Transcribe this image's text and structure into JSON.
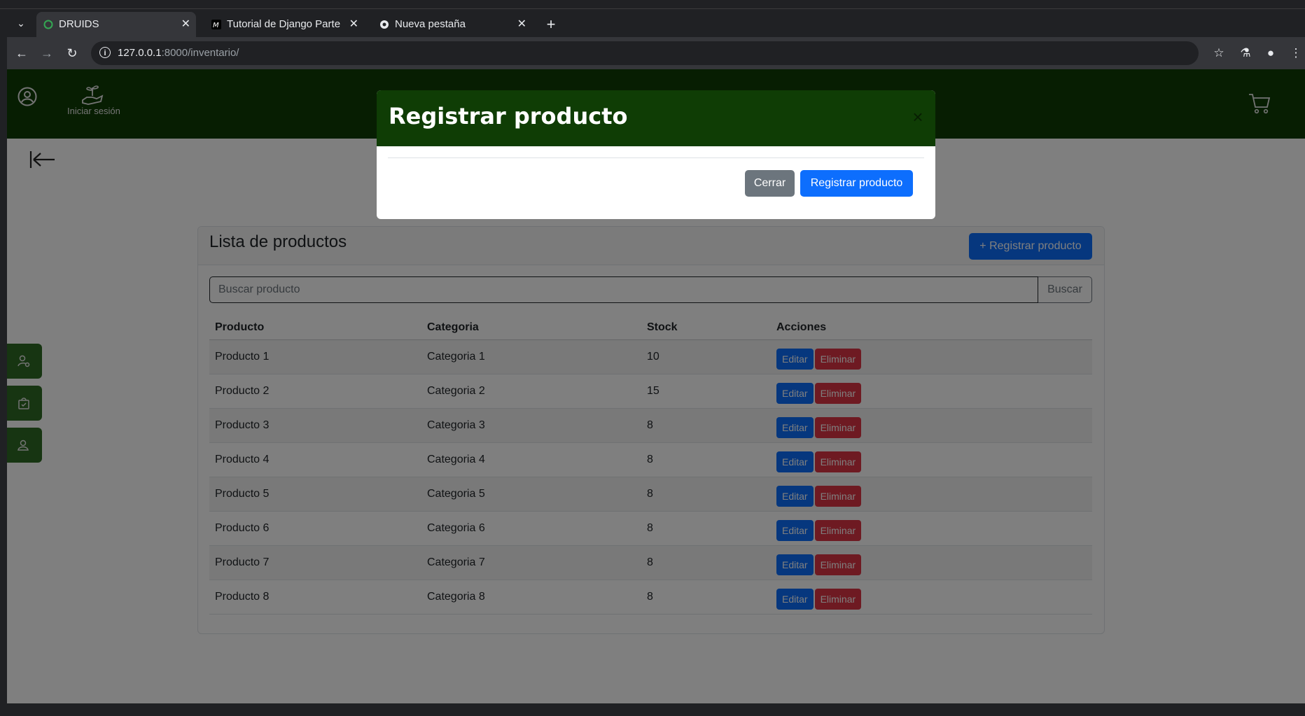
{
  "browser": {
    "tabs": [
      {
        "title": "DRUIDS",
        "active": true,
        "icon": "druids-favicon"
      },
      {
        "title": "Tutorial de Django Parte",
        "active": false,
        "icon": "m-favicon"
      },
      {
        "title": "Nueva pestaña",
        "active": false,
        "icon": "chrome-favicon"
      }
    ],
    "url_host": "127.0.0.1",
    "url_rest": ":8000/inventario/"
  },
  "header": {
    "login_text": "Iniciar sesión"
  },
  "card": {
    "title": "Lista de productos",
    "register_button": "+ Registrar producto",
    "search_placeholder": "Buscar producto",
    "search_button": "Buscar",
    "columns": [
      "Producto",
      "Categoria",
      "Stock",
      "Acciones"
    ],
    "rows": [
      {
        "producto": "Producto 1",
        "categoria": "Categoria 1",
        "stock": "10"
      },
      {
        "producto": "Producto 2",
        "categoria": "Categoria 2",
        "stock": "15"
      },
      {
        "producto": "Producto 3",
        "categoria": "Categoria 3",
        "stock": "8"
      },
      {
        "producto": "Producto 4",
        "categoria": "Categoria 4",
        "stock": "8"
      },
      {
        "producto": "Producto 5",
        "categoria": "Categoria 5",
        "stock": "8"
      },
      {
        "producto": "Producto 6",
        "categoria": "Categoria 6",
        "stock": "8"
      },
      {
        "producto": "Producto 7",
        "categoria": "Categoria 7",
        "stock": "8"
      },
      {
        "producto": "Producto 8",
        "categoria": "Categoria 8",
        "stock": "8"
      }
    ],
    "edit_label": "Editar",
    "delete_label": "Eliminar"
  },
  "modal": {
    "title": "Registrar producto",
    "close_button": "Cerrar",
    "submit_button": "Registrar producto"
  },
  "colors": {
    "header_green": "#0f3d05",
    "primary": "#0d6efd",
    "danger": "#dc3545",
    "secondary": "#6c757d"
  }
}
